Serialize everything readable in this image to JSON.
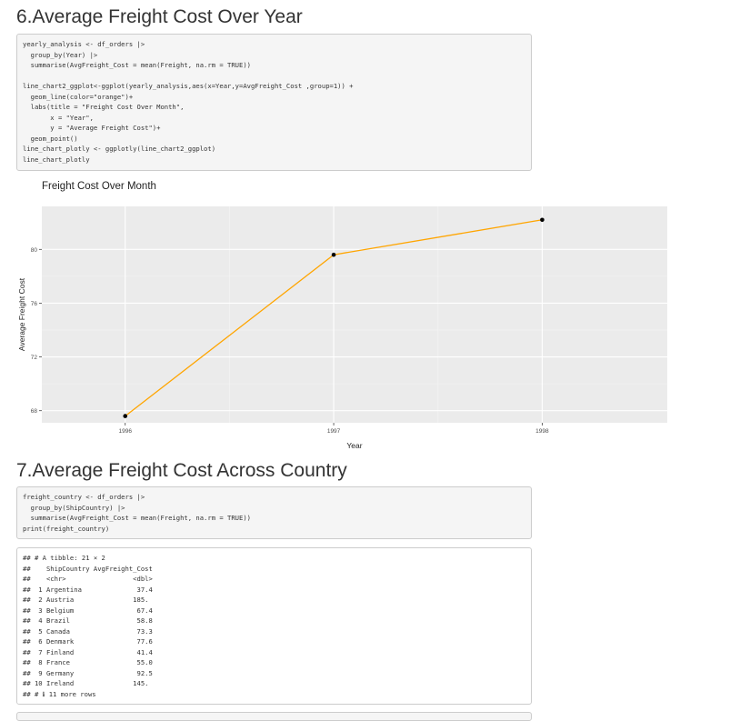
{
  "section6": {
    "heading": "6.Average Freight Cost Over Year",
    "code_lines": [
      "yearly_analysis <- df_orders |>",
      "  group_by(Year) |>",
      "  summarise(AvgFreight_Cost = mean(Freight, na.rm = TRUE))",
      "",
      "line_chart2_ggplot<-ggplot(yearly_analysis,aes(x=Year,y=AvgFreight_Cost ,group=1)) +",
      "  geom_line(color=\"orange\")+",
      "  labs(title = \"Freight Cost Over Month\",",
      "       x = \"Year\",",
      "       y = \"Average Freight Cost\")+",
      "  geom_point()",
      "line_chart_plotly <- ggplotly(line_chart2_ggplot)",
      "line_chart_plotly"
    ]
  },
  "chart_data": {
    "type": "line",
    "title": "Freight Cost Over Month",
    "xlabel": "Year",
    "ylabel": "Average Freight Cost",
    "x": [
      1996,
      1997,
      1998
    ],
    "y": [
      67.6,
      79.6,
      82.2
    ],
    "xticks": [
      "1996",
      "1997",
      "1998"
    ],
    "yticks": [
      68,
      72,
      76,
      80
    ],
    "xlim": [
      1995.6,
      1998.6
    ],
    "ylim": [
      67.1,
      83.2
    ],
    "line_color": "#FFA500",
    "point_color": "#000000",
    "panel_color": "#EBEBEB",
    "grid": true
  },
  "section7": {
    "heading": "7.Average Freight Cost Across Country",
    "code_lines": [
      "freight_country <- df_orders |>",
      "  group_by(ShipCountry) |>",
      "  summarise(AvgFreight_Cost = mean(Freight, na.rm = TRUE))",
      "print(freight_country)"
    ],
    "output_lines": [
      "## # A tibble: 21 × 2",
      "##    ShipCountry AvgFreight_Cost",
      "##    <chr>                 <dbl>",
      "##  1 Argentina              37.4",
      "##  2 Austria               185. ",
      "##  3 Belgium                67.4",
      "##  4 Brazil                 58.8",
      "##  5 Canada                 73.3",
      "##  6 Denmark                77.6",
      "##  7 Finland                41.4",
      "##  8 France                 55.0",
      "##  9 Germany                92.5",
      "## 10 Ireland               145. ",
      "## # ℹ 11 more rows"
    ]
  }
}
